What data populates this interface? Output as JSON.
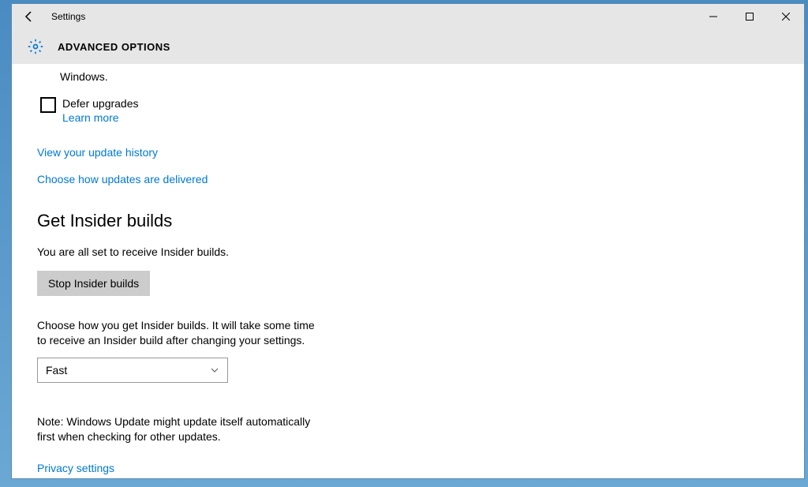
{
  "titlebar": {
    "app_name": "Settings"
  },
  "header": {
    "heading": "ADVANCED OPTIONS"
  },
  "truncated_top": "Windows.",
  "checkbox": {
    "label": "Defer upgrades",
    "learn_more": "Learn more"
  },
  "links": {
    "history": "View your update history",
    "delivered": "Choose how updates are delivered",
    "privacy": "Privacy settings"
  },
  "insider": {
    "heading": "Get Insider builds",
    "status": "You are all set to receive Insider builds.",
    "stop_btn": "Stop Insider builds",
    "description": "Choose how you get Insider builds. It will take some time to receive an Insider build after changing your settings.",
    "selected": "Fast",
    "note": "Note: Windows Update might update itself automatically first when checking for other updates."
  }
}
